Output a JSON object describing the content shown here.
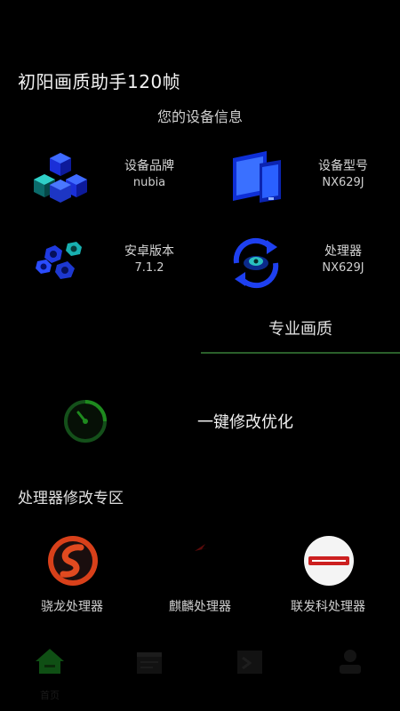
{
  "app": {
    "title": "初阳画质助手120帧"
  },
  "device_info": {
    "heading": "您的设备信息",
    "cards": [
      {
        "icon": "cubes-icon",
        "label": "设备品牌",
        "value": "nubia"
      },
      {
        "icon": "devices-icon",
        "label": "设备型号",
        "value": "NX629J"
      },
      {
        "icon": "nuts-icon",
        "label": "安卓版本",
        "value": "7.1.2"
      },
      {
        "icon": "processor-refresh-icon",
        "label": "处理器",
        "value": "NX629J"
      }
    ]
  },
  "tab": {
    "label": "专业画质",
    "accent": "#2a5f2a"
  },
  "optimize": {
    "label": "一键修改优化",
    "icon": "speedometer-icon",
    "accent": "#1e8a1e"
  },
  "processors": {
    "heading": "处理器修改专区",
    "items": [
      {
        "name": "骁龙处理器",
        "icon": "snapdragon-logo-icon"
      },
      {
        "name": "麒麟处理器",
        "icon": "kirin-logo-icon"
      },
      {
        "name": "联发科处理器",
        "icon": "mediatek-logo-icon"
      }
    ]
  },
  "bottom_nav": {
    "items": [
      {
        "icon": "home-icon",
        "label": "首页"
      },
      {
        "icon": "calendar-icon",
        "label": ""
      },
      {
        "icon": "terminal-icon",
        "label": ""
      },
      {
        "icon": "user-icon",
        "label": ""
      }
    ]
  }
}
